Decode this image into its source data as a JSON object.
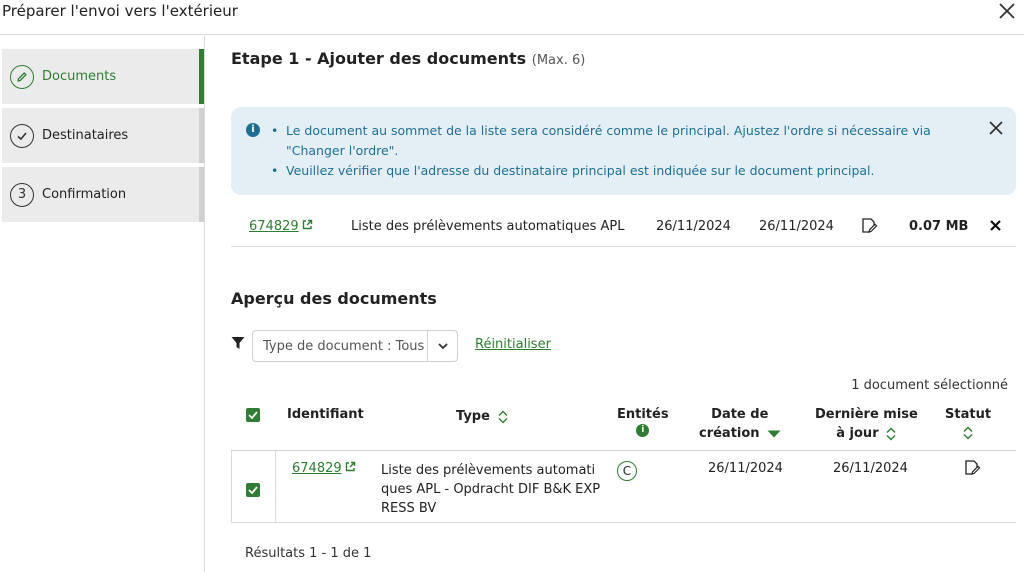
{
  "dialog": {
    "title": "Préparer l'envoi vers l'extérieur"
  },
  "sidebar": {
    "steps": [
      {
        "label": "Documents",
        "marker": "pencil-icon",
        "state": "active"
      },
      {
        "label": "Destinataires",
        "marker": "check-icon",
        "state": "done"
      },
      {
        "label": "Confirmation",
        "marker": "3",
        "state": "todo"
      }
    ]
  },
  "main": {
    "step_title": "Etape 1 - Ajouter des documents",
    "step_max": "(Max. 6)",
    "info": {
      "line1": "Le document au sommet de la liste sera considéré comme le principal. Ajustez l'ordre si nécessaire via \"Changer l'ordre\".",
      "line2": "Veuillez vérifier que l'adresse du destinataire principal est indiquée sur le document principal."
    },
    "added_document": {
      "id": "674829",
      "name": "Liste des prélèvements automatiques APL",
      "date1": "26/11/2024",
      "date2": "26/11/2024",
      "size": "0.07 MB"
    },
    "preview": {
      "title": "Aperçu des documents",
      "filter_value": "Type de document : Tous",
      "reset_label": "Réinitialiser",
      "selected_count": "1 document sélectionné",
      "columns": {
        "identifiant": "Identifiant",
        "type": "Type",
        "entites": "Entités",
        "date_creation_1": "Date de",
        "date_creation_2": "création",
        "derniere_mise_1": "Dernière mise",
        "derniere_mise_2": "à jour",
        "statut": "Statut"
      },
      "rows": [
        {
          "id": "674829",
          "type_line1": "Liste des prélèvements automati",
          "type_line2": "ques APL - Opdracht DIF B&K EXP",
          "type_line3": "RESS BV",
          "entity": "C",
          "date_creation": "26/11/2024",
          "date_update": "26/11/2024",
          "status_icon": "edit-document-icon"
        }
      ],
      "results": "Résultats 1 - 1 de 1"
    }
  },
  "colors": {
    "accent": "#2e7d32",
    "info_bg": "#e4eff5",
    "info_text": "#1f6f94"
  }
}
